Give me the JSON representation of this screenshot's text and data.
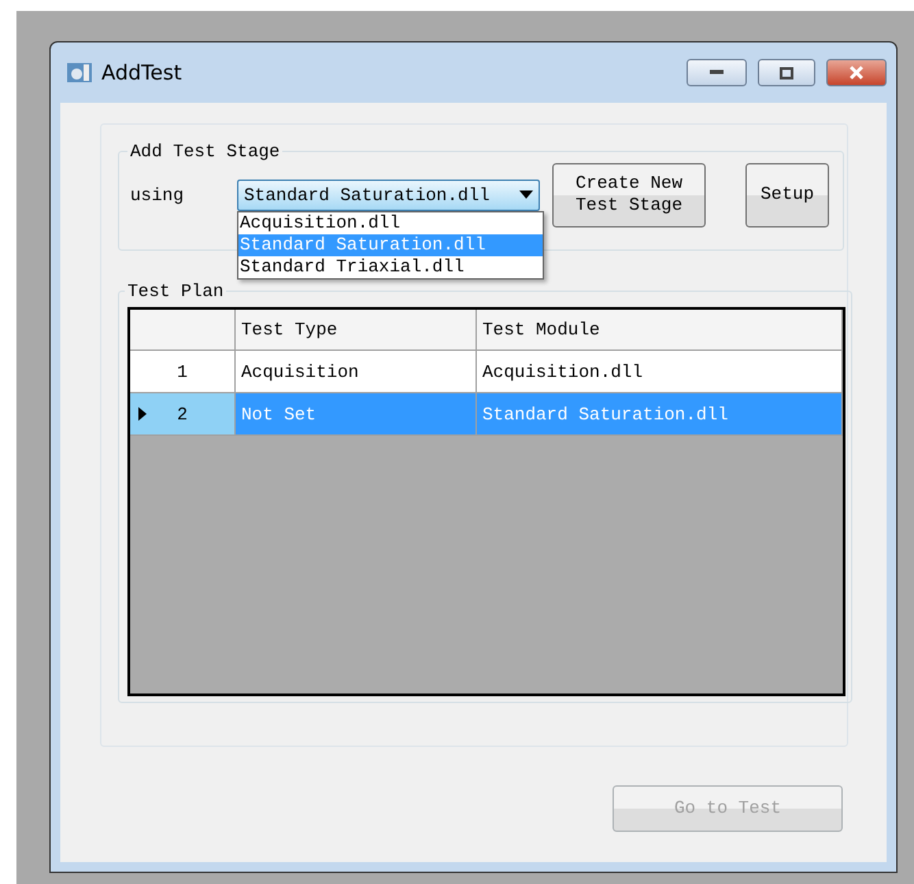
{
  "window": {
    "title": "AddTest"
  },
  "add_stage": {
    "title": "Add Test Stage",
    "using_label": "using",
    "combo": {
      "value": "Standard Saturation.dll"
    },
    "options": [
      {
        "label": "Acquisition.dll",
        "selected": false
      },
      {
        "label": "Standard Saturation.dll",
        "selected": true
      },
      {
        "label": "Standard Triaxial.dll",
        "selected": false
      }
    ],
    "buttons": [
      {
        "lines": [
          "Create New",
          "Test Stage"
        ]
      },
      {
        "lines": [
          "Setup"
        ]
      }
    ]
  },
  "test_plan": {
    "title": "Test Plan",
    "columns": [
      "Test Type",
      "Test Module"
    ],
    "rows": [
      {
        "number": "1",
        "cells": [
          "Acquisition",
          "Acquisition.dll"
        ],
        "selected": false
      },
      {
        "number": "2",
        "cells": [
          "Not Set",
          "Standard Saturation.dll"
        ],
        "selected": true
      }
    ]
  },
  "go_button": {
    "label": "Go to Test",
    "disabled": true
  }
}
